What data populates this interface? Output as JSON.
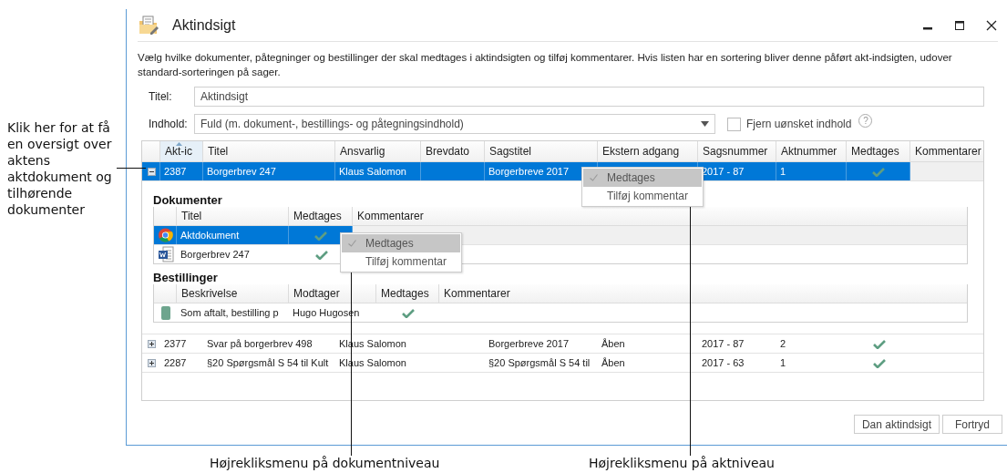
{
  "window": {
    "title": "Aktindsigt"
  },
  "description": "Vælg hvilke dokumenter, påtegninger og bestillinger der skal medtages i aktindsigten og tilføj kommentarer. Hvis listen har en sortering bliver denne påført akt-indsigten, udover standard-sorteringen på sager.",
  "title_field": {
    "label": "Titel:",
    "value": "Aktindsigt"
  },
  "content_field": {
    "label": "Indhold:",
    "value": "Fuld (m. dokument-, bestillings- og påtegningsindhold)"
  },
  "remove_option": {
    "label": "Fjern uønsket indhold",
    "checked": false,
    "help": "?"
  },
  "grid": {
    "columns": [
      "Akt-ic",
      "Titel",
      "Ansvarlig",
      "Brevdato",
      "Sagstitel",
      "Ekstern adgang",
      "Sagsnummer",
      "Aktnummer",
      "Medtages",
      "Kommentarer"
    ],
    "rows": [
      {
        "expanded": true,
        "selected": true,
        "included": true,
        "cells": [
          "2387",
          "Borgerbrev 247",
          "Klaus Salomon",
          null,
          "Borgerbreve 2017",
          null,
          "2017 - 87",
          "1"
        ],
        "documents": {
          "heading": "Dokumenter",
          "columns": [
            "Titel",
            "Medtages",
            "Kommentarer"
          ],
          "rows": [
            {
              "kind": "chrome",
              "title": "Aktdokument",
              "included": true,
              "selected": true
            },
            {
              "kind": "word",
              "title": "Borgerbrev 247",
              "included": true,
              "selected": false
            }
          ]
        },
        "orders": {
          "heading": "Bestillinger",
          "columns": [
            "Beskrivelse",
            "Modtager",
            "Medtages",
            "Kommentarer"
          ],
          "rows": [
            {
              "kind": "order",
              "cells": [
                "Som aftalt, bestilling p",
                "Hugo Hugosen"
              ],
              "included": true,
              "selected": false
            }
          ]
        }
      },
      {
        "expanded": false,
        "selected": false,
        "included": true,
        "cells": [
          "2377",
          "Svar på borgerbrev 498",
          "Klaus Salomon",
          null,
          "Borgerbreve 2017",
          "Åben",
          "2017 - 87",
          "2"
        ]
      },
      {
        "expanded": false,
        "selected": false,
        "included": true,
        "cells": [
          "2287",
          "§20 Spørgsmål S 54 til Kult",
          "Klaus Salomon",
          null,
          "§20 Spørgsmål S 54 til",
          "Åben",
          "2017 - 63",
          "1"
        ]
      }
    ]
  },
  "context_menus": [
    {
      "items": [
        {
          "label": "Medtages",
          "checked": true,
          "highlighted": true
        },
        {
          "label": "Tilføj kommentar",
          "checked": false,
          "highlighted": false
        }
      ]
    },
    {
      "items": [
        {
          "label": "Medtages",
          "checked": true,
          "highlighted": true
        },
        {
          "label": "Tilføj kommentar",
          "checked": false,
          "highlighted": false
        }
      ]
    }
  ],
  "buttons": [
    "Dan aktindsigt",
    "Fortryd"
  ],
  "annotations": {
    "side_note": "Klik her for at få en oversigt over aktens aktdokument og tilhørende dokumenter",
    "captions": [
      "Højrekliksmenu på dokumentniveau",
      "Højrekliksmenu på aktniveau"
    ]
  }
}
